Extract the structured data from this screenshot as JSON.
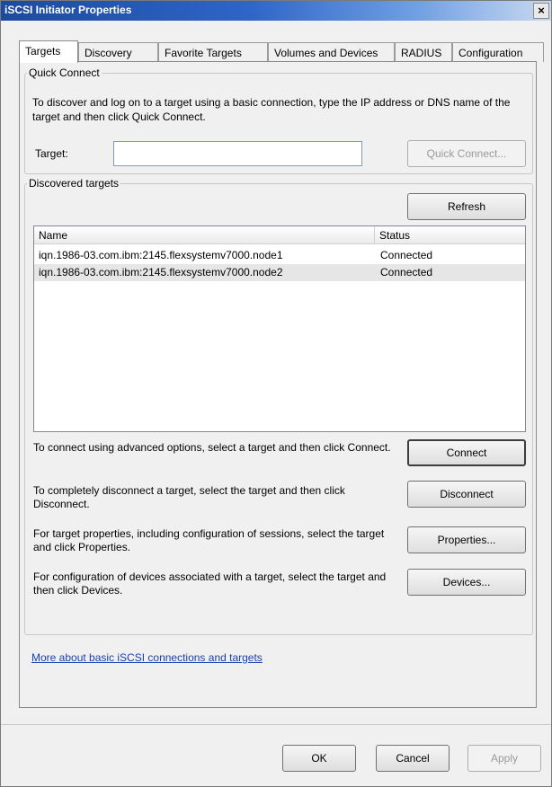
{
  "window": {
    "title": "iSCSI Initiator Properties",
    "close_glyph": "×"
  },
  "tabs": [
    {
      "label": "Targets",
      "active": true
    },
    {
      "label": "Discovery",
      "active": false
    },
    {
      "label": "Favorite Targets",
      "active": false
    },
    {
      "label": "Volumes and Devices",
      "active": false
    },
    {
      "label": "RADIUS",
      "active": false
    },
    {
      "label": "Configuration",
      "active": false
    }
  ],
  "quick_connect": {
    "legend": "Quick Connect",
    "description": "To discover and log on to a target using a basic connection, type the IP address or DNS name of the target and then click Quick Connect.",
    "target_label": "Target:",
    "target_value": "",
    "button_label": "Quick Connect...",
    "button_enabled": false
  },
  "discovered": {
    "legend": "Discovered targets",
    "refresh_label": "Refresh",
    "columns": [
      "Name",
      "Status"
    ],
    "rows": [
      {
        "name": "iqn.1986-03.com.ibm:2145.flexsystemv7000.node1",
        "status": "Connected"
      },
      {
        "name": "iqn.1986-03.com.ibm:2145.flexsystemv7000.node2",
        "status": "Connected"
      }
    ]
  },
  "actions": [
    {
      "text": "To connect using advanced options, select a target and then click Connect.",
      "button": "Connect"
    },
    {
      "text": "To completely disconnect a target, select the target and then click Disconnect.",
      "button": "Disconnect"
    },
    {
      "text": "For target properties, including configuration of sessions, select the target and click Properties.",
      "button": "Properties..."
    },
    {
      "text": "For configuration of devices associated with a target, select the target and then click Devices.",
      "button": "Devices..."
    }
  ],
  "help_link": "More about basic iSCSI connections and targets",
  "footer": {
    "ok_label": "OK",
    "cancel_label": "Cancel",
    "apply_label": "Apply",
    "apply_enabled": false
  },
  "colors": {
    "titlebar": "#2f64c8",
    "link": "#1a3fb0",
    "selected_row": "#e6e6e6"
  }
}
